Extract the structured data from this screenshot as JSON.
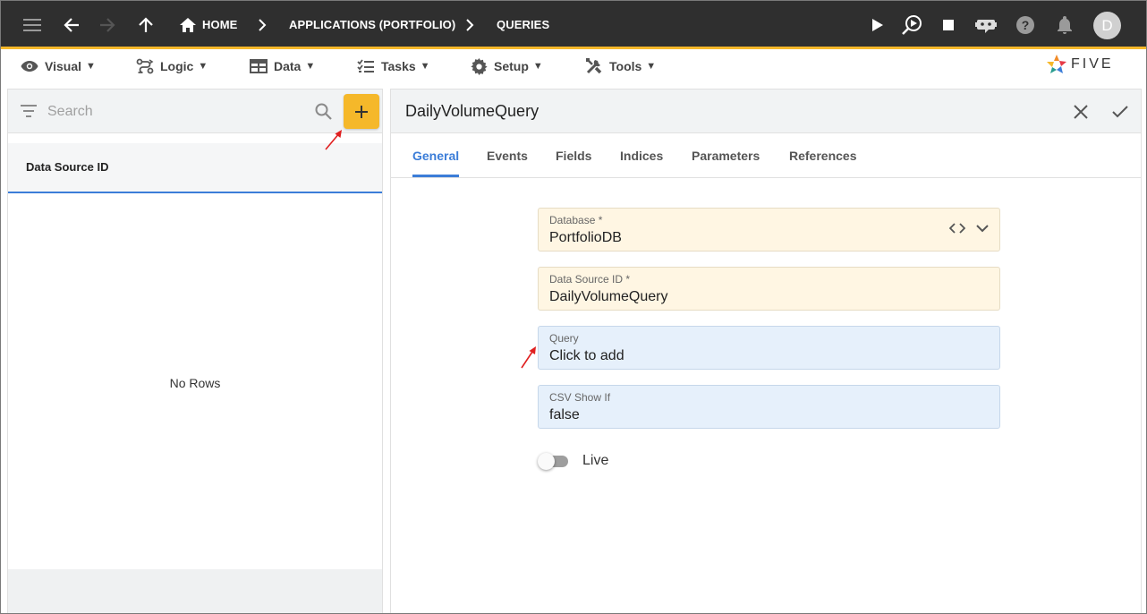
{
  "topbar": {
    "crumbs": {
      "home": "HOME",
      "applications": "APPLICATIONS (PORTFOLIO)",
      "queries": "QUERIES"
    },
    "avatar_letter": "D",
    "accent_color": "#f5b82a",
    "background_color": "#2f2f2f"
  },
  "menubar": {
    "items": [
      {
        "label": "Visual",
        "icon": "eye-icon"
      },
      {
        "label": "Logic",
        "icon": "logic-icon"
      },
      {
        "label": "Data",
        "icon": "table-icon"
      },
      {
        "label": "Tasks",
        "icon": "checklist-icon"
      },
      {
        "label": "Setup",
        "icon": "gear-icon"
      },
      {
        "label": "Tools",
        "icon": "tools-icon"
      }
    ],
    "caret": "▼",
    "logo_text": "FIVE"
  },
  "list_panel": {
    "search_placeholder": "Search",
    "column_header": "Data Source ID",
    "empty_text": "No Rows"
  },
  "form": {
    "title": "DailyVolumeQuery",
    "tabs": [
      "General",
      "Events",
      "Fields",
      "Indices",
      "Parameters",
      "References"
    ],
    "active_tab": "General",
    "fields": {
      "database": {
        "label": "Database *",
        "value": "PortfolioDB"
      },
      "data_source_id": {
        "label": "Data Source ID *",
        "value": "DailyVolumeQuery"
      },
      "query": {
        "label": "Query",
        "value": "Click to add"
      },
      "csv_show_if": {
        "label": "CSV Show If",
        "value": "false"
      }
    },
    "live_toggle": {
      "label": "Live",
      "on": false
    }
  },
  "colors": {
    "active_tab": "#3b7dd8",
    "required_field_bg": "#fff6e3",
    "optional_field_bg": "#e6f0fb",
    "annotation_arrow": "#e02020"
  }
}
